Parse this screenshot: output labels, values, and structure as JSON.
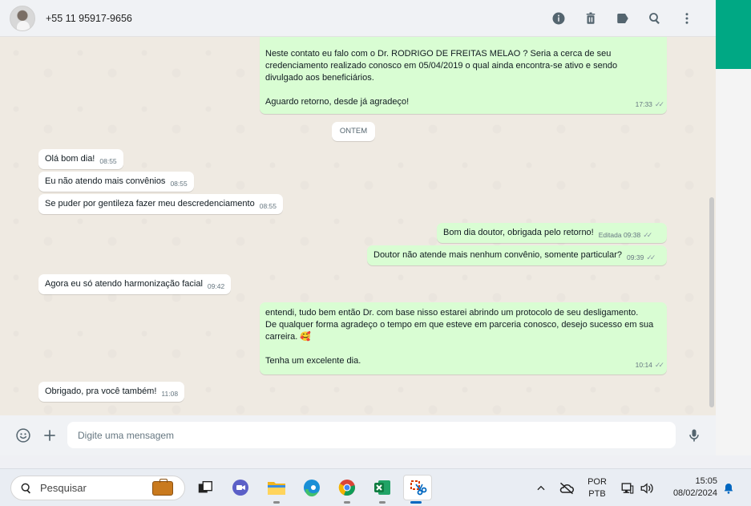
{
  "header": {
    "contact_name": "+55 11 95917-9656",
    "icons": [
      "info-icon",
      "delete-icon",
      "label-icon",
      "search-icon",
      "more-options-icon"
    ]
  },
  "messages": [
    {
      "direction": "out",
      "lines": [
        "Neste contato eu falo com o Dr. RODRIGO DE FREITAS MELAO ? Seria a cerca de seu",
        "credenciamento realizado conosco em 05/04/2019 o qual ainda encontra-se ativo e sendo",
        "divulgado aos beneficiários.",
        "",
        "Aguardo retorno, desde já agradeço!"
      ],
      "time": "17:33",
      "ticks": "✓✓"
    },
    {
      "direction": "day",
      "text": "ONTEM"
    },
    {
      "direction": "in",
      "text": "Olá bom dia!",
      "time": "08:55"
    },
    {
      "direction": "in",
      "text": "Eu não atendo mais convênios",
      "time": "08:55"
    },
    {
      "direction": "in",
      "text": "Se puder por gentileza fazer meu descredenciamento",
      "time": "08:55"
    },
    {
      "direction": "out",
      "text": "Bom dia doutor, obrigada pelo retorno!",
      "time": "Editada 09:38",
      "ticks": "✓✓"
    },
    {
      "direction": "out",
      "text": "Doutor não atende mais nenhum convênio, somente particular?",
      "time": "09:39",
      "ticks": "✓✓"
    },
    {
      "direction": "in",
      "text": "Agora eu só atendo harmonização facial",
      "time": "09:42"
    },
    {
      "direction": "out",
      "lines": [
        "entendi, tudo bem então Dr. com base nisso estarei abrindo um protocolo de seu desligamento.",
        "De qualquer forma agradeço o tempo em que esteve em parceria conosco, desejo sucesso em sua",
        "carreira. 🥰",
        "",
        "Tenha um excelente dia."
      ],
      "time": "10:14",
      "ticks": "✓✓"
    },
    {
      "direction": "in",
      "text": "Obrigado, pra você também!",
      "time": "11:08"
    }
  ],
  "composer": {
    "placeholder": "Digite uma mensagem",
    "icons": [
      "emoji-icon",
      "attach-plus-icon",
      "microphone-icon"
    ]
  },
  "taskbar": {
    "search_label": "Pesquisar",
    "apps": [
      "task-view-icon",
      "teams-icon",
      "file-explorer-icon",
      "edge-icon",
      "chrome-icon",
      "excel-icon",
      "snipping-tool-icon"
    ],
    "language_line1": "POR",
    "language_line2": "PTB",
    "time": "15:05",
    "date": "08/02/2024"
  },
  "colors": {
    "outgoing_bubble": "#d9fdd3",
    "incoming_bubble": "#ffffff",
    "chat_background": "#efeae2",
    "accent": "#00a884"
  }
}
